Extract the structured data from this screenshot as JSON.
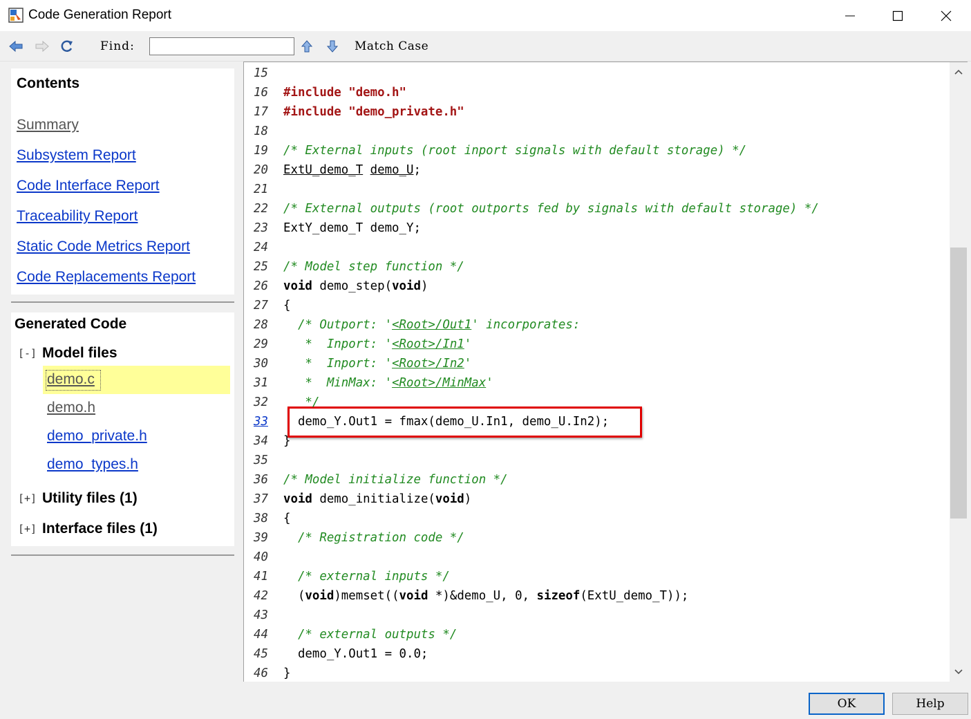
{
  "window": {
    "title": "Code Generation Report",
    "icons": [
      "app-icon",
      "minimize-icon",
      "maximize-icon",
      "close-icon"
    ]
  },
  "toolbar": {
    "icons": [
      "back-arrow-icon",
      "forward-arrow-icon",
      "refresh-icon",
      "find-up-icon",
      "find-down-icon"
    ],
    "find_label": "Find:",
    "find_value": "",
    "match_case_label": "Match Case"
  },
  "contents": {
    "title": "Contents",
    "links": [
      {
        "label": "Summary",
        "visited": true
      },
      {
        "label": "Subsystem Report",
        "visited": false
      },
      {
        "label": "Code Interface Report",
        "visited": false
      },
      {
        "label": "Traceability Report",
        "visited": false
      },
      {
        "label": "Static Code Metrics Report",
        "visited": false
      },
      {
        "label": "Code Replacements Report",
        "visited": false
      }
    ]
  },
  "generated_code": {
    "title": "Generated Code",
    "model_files": {
      "toggle": "[-]",
      "label": "Model files",
      "files": [
        "demo.c",
        "demo.h",
        "demo_private.h",
        "demo_types.h"
      ],
      "current": "demo.c"
    },
    "utility_files": {
      "toggle": "[+]",
      "label": "Utility files (1)"
    },
    "interface_files": {
      "toggle": "[+]",
      "label": "Interface files (1)"
    }
  },
  "code": {
    "lines": [
      {
        "n": "15",
        "text": ""
      },
      {
        "n": "16",
        "text": "#include \"demo.h\""
      },
      {
        "n": "17",
        "text": "#include \"demo_private.h\""
      },
      {
        "n": "18",
        "text": ""
      },
      {
        "n": "19",
        "text": "/* External inputs (root inport signals with default storage) */"
      },
      {
        "n": "20",
        "text": "ExtU_demo_T demo_U;"
      },
      {
        "n": "21",
        "text": ""
      },
      {
        "n": "22",
        "text": "/* External outputs (root outports fed by signals with default storage) */"
      },
      {
        "n": "23",
        "text": "ExtY_demo_T demo_Y;"
      },
      {
        "n": "24",
        "text": ""
      },
      {
        "n": "25",
        "text": "/* Model step function */"
      },
      {
        "n": "26",
        "text": "void demo_step(void)"
      },
      {
        "n": "27",
        "text": "{"
      },
      {
        "n": "28",
        "text": "  /* Outport: '<Root>/Out1' incorporates:"
      },
      {
        "n": "29",
        "text": "   *  Inport: '<Root>/In1'"
      },
      {
        "n": "30",
        "text": "   *  Inport: '<Root>/In2'"
      },
      {
        "n": "31",
        "text": "   *  MinMax: '<Root>/MinMax'"
      },
      {
        "n": "32",
        "text": "   */"
      },
      {
        "n": "33",
        "text": "  demo_Y.Out1 = fmax(demo_U.In1, demo_U.In2);"
      },
      {
        "n": "34",
        "text": "}"
      },
      {
        "n": "35",
        "text": ""
      },
      {
        "n": "36",
        "text": "/* Model initialize function */"
      },
      {
        "n": "37",
        "text": "void demo_initialize(void)"
      },
      {
        "n": "38",
        "text": "{"
      },
      {
        "n": "39",
        "text": "  /* Registration code */"
      },
      {
        "n": "40",
        "text": ""
      },
      {
        "n": "41",
        "text": "  /* external inputs */"
      },
      {
        "n": "42",
        "text": "  (void)memset((void *)&demo_U, 0, sizeof(ExtU_demo_T));"
      },
      {
        "n": "43",
        "text": ""
      },
      {
        "n": "44",
        "text": "  /* external outputs */"
      },
      {
        "n": "45",
        "text": "  demo_Y.Out1 = 0.0;"
      },
      {
        "n": "46",
        "text": "}"
      }
    ],
    "highlighted_line": "33"
  },
  "buttons": {
    "ok": "OK",
    "help": "Help"
  },
  "colors": {
    "link": "#0b38c9",
    "comment": "#228b22",
    "preprocessor": "#a31515",
    "highlight_box": "#e00000",
    "current_file_bg": "#ffff99"
  }
}
